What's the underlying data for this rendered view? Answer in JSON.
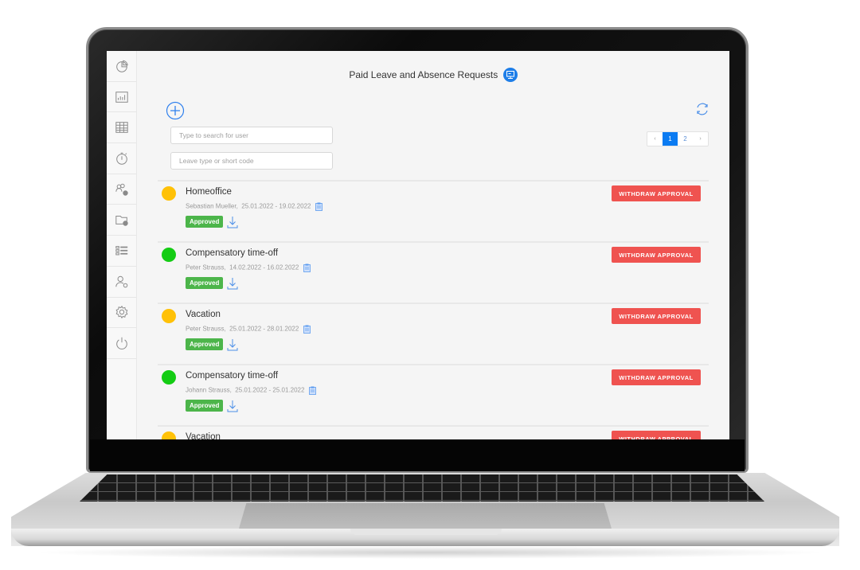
{
  "header": {
    "title": "Paid Leave and Absence Requests",
    "title_icon": "monitor-badge-icon",
    "accent_color": "#1e7ee8"
  },
  "sidebar": {
    "items": [
      {
        "icon": "pie-chart-icon"
      },
      {
        "icon": "bar-chart-icon"
      },
      {
        "icon": "calendar-grid-icon"
      },
      {
        "icon": "stopwatch-icon"
      },
      {
        "icon": "users-settings-icon"
      },
      {
        "icon": "folder-settings-icon"
      },
      {
        "icon": "list-icon"
      },
      {
        "icon": "user-settings-icon"
      },
      {
        "icon": "gear-icon"
      },
      {
        "icon": "power-icon"
      }
    ]
  },
  "toolbar": {
    "add_icon": "plus-circle-icon",
    "refresh_icon": "refresh-icon"
  },
  "filters": {
    "search_placeholder": "Type to search for user",
    "search_value": "",
    "leave_placeholder": "Leave type or short code",
    "leave_value": ""
  },
  "pagination": {
    "prev": "‹",
    "pages": [
      "1",
      "2"
    ],
    "current": "1",
    "next": "›",
    "active_color": "#0b7bf2"
  },
  "status_colors": {
    "yellow": "#ffc107",
    "green": "#14cc14",
    "approved": "#4cb54a",
    "withdraw": "#ef5350"
  },
  "requests": [
    {
      "type": "Homeoffice",
      "user": "Sebastian Mueller,",
      "range": "25.01.2022 - 19.02.2022",
      "status": "Approved",
      "dot_color": "#ffc107",
      "action": "WITHDRAW APPROVAL"
    },
    {
      "type": "Compensatory time-off",
      "user": "Peter Strauss,",
      "range": "14.02.2022 - 16.02.2022",
      "status": "Approved",
      "dot_color": "#14cc14",
      "action": "WITHDRAW APPROVAL"
    },
    {
      "type": "Vacation",
      "user": "Peter Strauss,",
      "range": "25.01.2022 - 28.01.2022",
      "status": "Approved",
      "dot_color": "#ffc107",
      "action": "WITHDRAW APPROVAL"
    },
    {
      "type": "Compensatory time-off",
      "user": "Johann Strauss,",
      "range": "25.01.2022 - 25.01.2022",
      "status": "Approved",
      "dot_color": "#14cc14",
      "action": "WITHDRAW APPROVAL"
    },
    {
      "type": "Vacation",
      "user": "",
      "range": "",
      "status": "",
      "dot_color": "#ffc107",
      "action": "WITHDRAW APPROVAL"
    }
  ]
}
